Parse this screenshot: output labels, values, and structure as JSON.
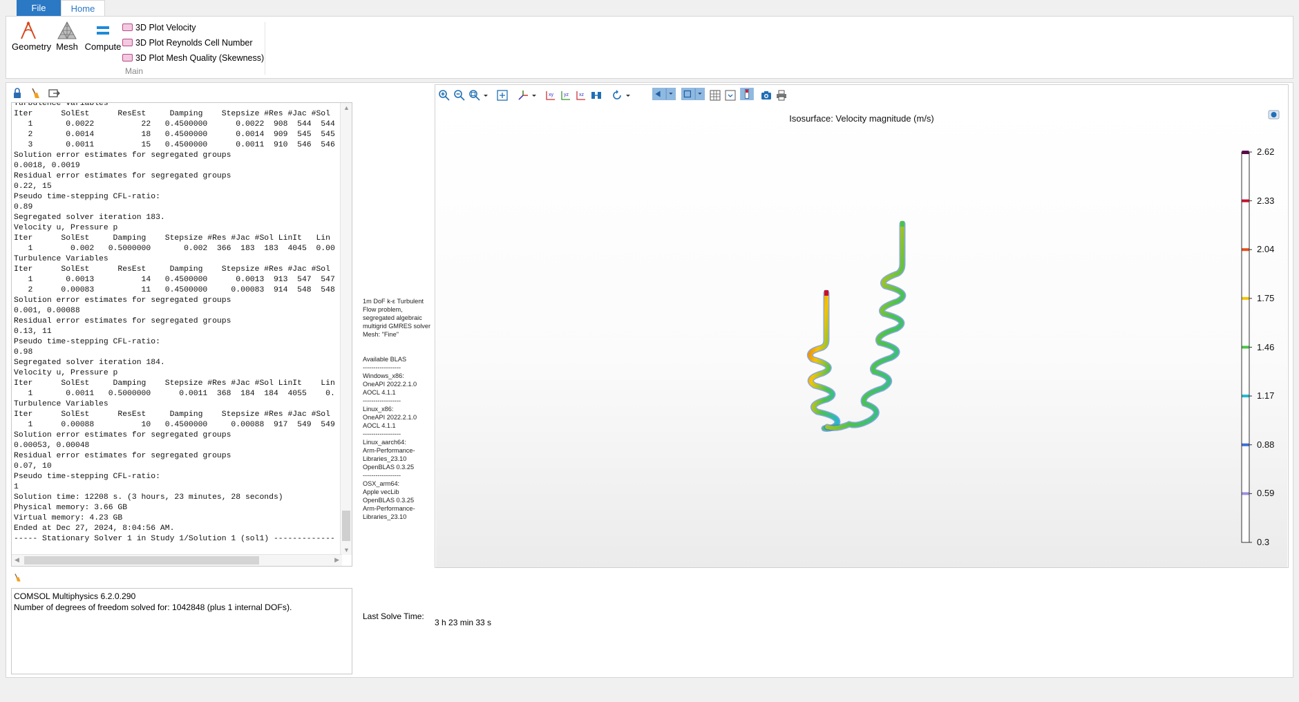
{
  "ribbon": {
    "tabs": {
      "file": "File",
      "home": "Home"
    },
    "buttons": {
      "geometry": "Geometry",
      "mesh": "Mesh",
      "compute": "Compute"
    },
    "plot_items": [
      "3D Plot Velocity",
      "3D Plot Reynolds Cell Number",
      "3D Plot Mesh Quality (Skewness)"
    ],
    "group_label": "Main"
  },
  "log": {
    "lines": [
      "Turbulence Variables",
      "Iter      SolEst      ResEst     Damping    Stepsize #Res #Jac #Sol",
      "   1       0.0022          22   0.4500000      0.0022  908  544  544",
      "   2       0.0014          18   0.4500000      0.0014  909  545  545",
      "   3       0.0011          15   0.4500000      0.0011  910  546  546",
      "Solution error estimates for segregated groups",
      "0.0018, 0.0019",
      "Residual error estimates for segregated groups",
      "0.22, 15",
      "Pseudo time-stepping CFL-ratio:",
      "0.89",
      "Segregated solver iteration 183.",
      "Velocity u, Pressure p",
      "Iter      SolEst     Damping    Stepsize #Res #Jac #Sol LinIt   Lin",
      "   1        0.002   0.5000000       0.002  366  183  183  4045  0.00",
      "Turbulence Variables",
      "Iter      SolEst      ResEst     Damping    Stepsize #Res #Jac #Sol",
      "   1       0.0013          14   0.4500000      0.0013  913  547  547",
      "   2      0.00083          11   0.4500000     0.00083  914  548  548",
      "Solution error estimates for segregated groups",
      "0.001, 0.00088",
      "Residual error estimates for segregated groups",
      "0.13, 11",
      "Pseudo time-stepping CFL-ratio:",
      "0.98",
      "Segregated solver iteration 184.",
      "Velocity u, Pressure p",
      "Iter      SolEst     Damping    Stepsize #Res #Jac #Sol LinIt    Lin",
      "   1       0.0011   0.5000000      0.0011  368  184  184  4055    0.",
      "Turbulence Variables",
      "Iter      SolEst      ResEst     Damping    Stepsize #Res #Jac #Sol",
      "   1      0.00088          10   0.4500000     0.00088  917  549  549",
      "Solution error estimates for segregated groups",
      "0.00053, 0.00048",
      "Residual error estimates for segregated groups",
      "0.07, 10",
      "Pseudo time-stepping CFL-ratio:",
      "1",
      "Solution time: 12208 s. (3 hours, 23 minutes, 28 seconds)",
      "Physical memory: 3.66 GB",
      "Virtual memory: 4.23 GB",
      "Ended at Dec 27, 2024, 8:04:56 AM.",
      "----- Stationary Solver 1 in Study 1/Solution 1 (sol1) -------------"
    ]
  },
  "messages": {
    "line1": "COMSOL Multiphysics 6.2.0.290",
    "line2": "Number of degrees of freedom solved for: 1042848 (plus 1 internal DOFs)."
  },
  "info": {
    "lines": [
      "1m DoF k-ε Turbulent",
      "Flow problem,",
      "segregated algebraic",
      "multigrid GMRES solver",
      "Mesh: \"Fine\"",
      "",
      "",
      "Available BLAS",
      "------------------",
      "Windows_x86:",
      "OneAPI 2022.2.1.0",
      "AOCL 4.1.1",
      "------------------",
      "Linux_x86:",
      "OneAPI 2022.2.1.0",
      "AOCL 4.1.1",
      "------------------",
      "Linux_aarch64:",
      "Arm-Performance-",
      "Libraries_23.10",
      "OpenBLAS 0.3.25",
      "------------------",
      "OSX_arm64:",
      "Apple vecLib",
      "OpenBLAS 0.3.25",
      "Arm-Performance-",
      "Libraries_23.10"
    ],
    "last_solve_label": "Last Solve Time:",
    "last_solve_value": "3 h 23 min 33 s"
  },
  "graphics": {
    "toolbar_icons": [
      "zoom-in-icon",
      "zoom-out-icon",
      "zoom-box-icon",
      "zoom-extents-icon",
      "axis-orientation-icon",
      "view-xy-icon",
      "view-yz-icon",
      "view-xz-icon",
      "view-direction-icon",
      "rotate-icon",
      "scene-light-icon",
      "transparency-icon",
      "grid-icon",
      "show-axes-icon",
      "legend-toggle-icon",
      "camera-icon",
      "print-icon"
    ],
    "plot_title": "Isosurface: Velocity magnitude (m/s)",
    "colorbar": {
      "min": 0.3,
      "max": 2.62,
      "tick_labels": [
        "2.62",
        "2.33",
        "2.04",
        "1.75",
        "1.46",
        "1.17",
        "0.88",
        "0.59",
        "0.3"
      ],
      "colors": [
        "#5a0a4a",
        "#c8102e",
        "#e8501a",
        "#f5c400",
        "#4cc34a",
        "#22b8d0",
        "#3d6fd6",
        "#9a8fe0"
      ]
    }
  }
}
